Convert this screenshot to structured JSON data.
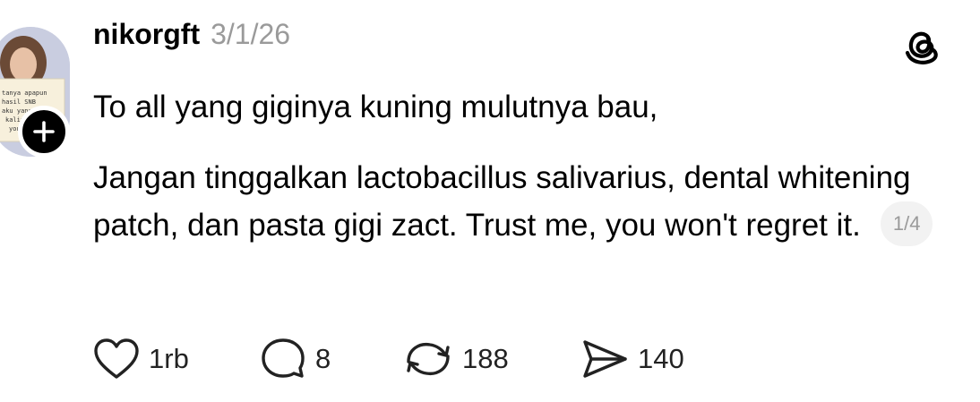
{
  "post": {
    "username": "nikorgft",
    "timestamp": "3/1/26",
    "avatar_sign_lines": [
      "tanya apapun",
      "hasil SNB",
      "aku yang",
      "kalian",
      "you"
    ],
    "text_lines": [
      "To all yang giginya kuning mulutnya bau,",
      "Jangan tinggalkan lactobacillus salivarius, dental whitening patch, dan pasta gigi zact. Trust me, you won't regret it."
    ],
    "page_indicator": "1/4"
  },
  "actions": {
    "like_count": "1rb",
    "reply_count": "8",
    "repost_count": "188",
    "share_count": "140"
  },
  "icons": {
    "avatar": "profile-photo",
    "follow": "plus-icon",
    "logo": "threads-logo-icon",
    "like": "heart-icon",
    "reply": "speech-bubble-icon",
    "repost": "repost-arrows-icon",
    "share": "send-paper-plane-icon"
  },
  "colors": {
    "text": "#000000",
    "muted": "#9a9a9a",
    "pill_bg": "#f2f2f2"
  }
}
